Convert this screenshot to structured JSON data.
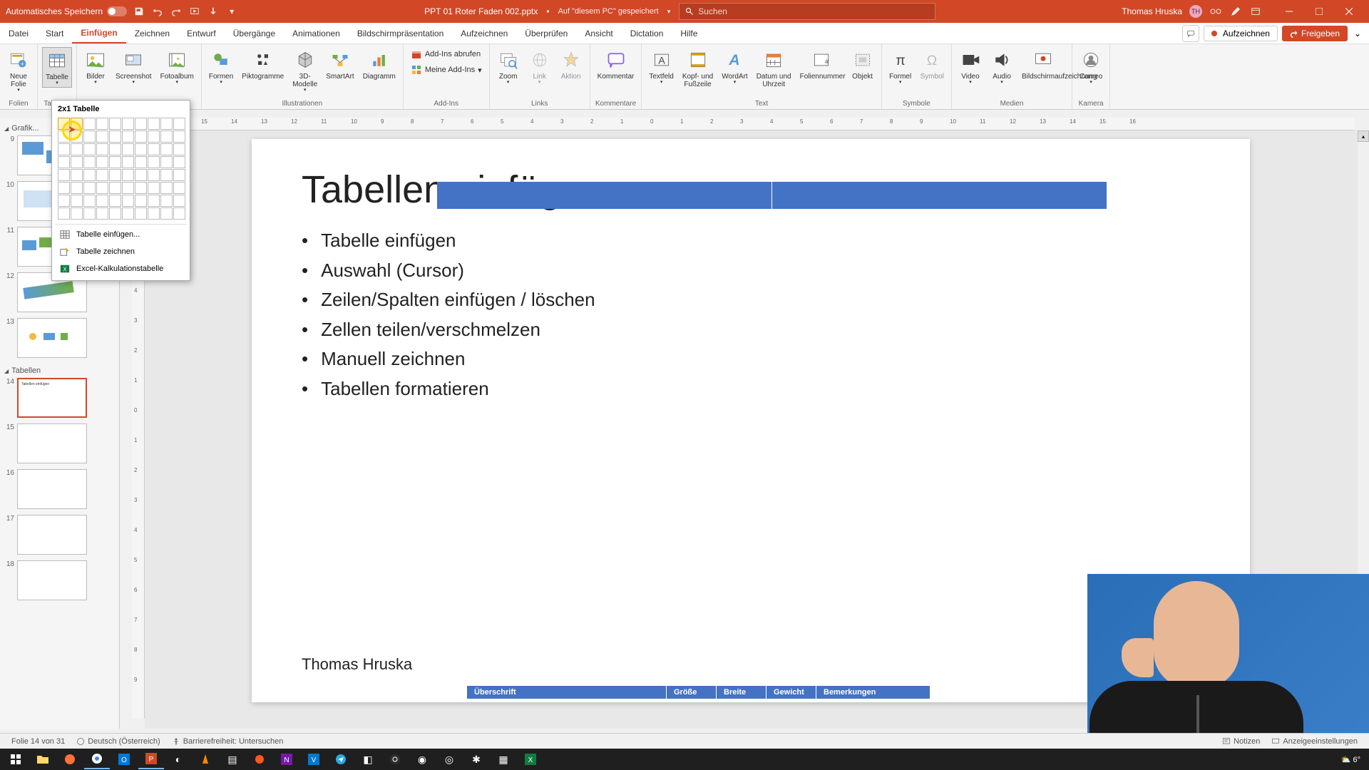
{
  "titlebar": {
    "autosave_label": "Automatisches Speichern",
    "filename": "PPT 01 Roter Faden 002.pptx",
    "saved_location": "Auf \"diesem PC\" gespeichert",
    "search_placeholder": "Suchen",
    "username": "Thomas Hruska",
    "user_initials": "TH"
  },
  "tabs": {
    "items": [
      "Datei",
      "Start",
      "Einfügen",
      "Zeichnen",
      "Entwurf",
      "Übergänge",
      "Animationen",
      "Bildschirmpräsentation",
      "Aufzeichnen",
      "Überprüfen",
      "Ansicht",
      "Dictation",
      "Hilfe"
    ],
    "active_index": 2,
    "record_label": "Aufzeichnen",
    "share_label": "Freigeben"
  },
  "ribbon": {
    "groups": {
      "folien": {
        "label": "Folien",
        "neue_folie": "Neue\nFolie"
      },
      "tabellen": {
        "label": "Tabellen",
        "tabelle": "Tabelle"
      },
      "bilder": {
        "label": "Bilder",
        "bilder": "Bilder",
        "screenshot": "Screenshot",
        "fotoalbum": "Fotoalbum"
      },
      "illustrationen": {
        "label": "Illustrationen",
        "formen": "Formen",
        "piktogramme": "Piktogramme",
        "3d": "3D-\nModelle",
        "smartart": "SmartArt",
        "diagramm": "Diagramm"
      },
      "addins": {
        "label": "Add-Ins",
        "abrufen": "Add-Ins abrufen",
        "meine": "Meine Add-Ins"
      },
      "links": {
        "label": "Links",
        "zoom": "Zoom",
        "link": "Link",
        "aktion": "Aktion"
      },
      "kommentare": {
        "label": "Kommentare",
        "kommentar": "Kommentar"
      },
      "text": {
        "label": "Text",
        "textfeld": "Textfeld",
        "kopf": "Kopf- und\nFußzeile",
        "wordart": "WordArt",
        "datum": "Datum und\nUhrzeit",
        "foliennummer": "Foliennummer",
        "objekt": "Objekt"
      },
      "symbole": {
        "label": "Symbole",
        "formel": "Formel",
        "symbol": "Symbol"
      },
      "medien": {
        "label": "Medien",
        "video": "Video",
        "audio": "Audio",
        "bildschirm": "Bildschirmaufzeichnung"
      },
      "kamera": {
        "label": "Kamera",
        "cameo": "Cameo"
      }
    }
  },
  "table_dropdown": {
    "title": "2x1 Tabelle",
    "cols_selected": 2,
    "rows_selected": 1,
    "insert_table": "Tabelle einfügen...",
    "draw_table": "Tabelle zeichnen",
    "excel_table": "Excel-Kalkulationstabelle"
  },
  "sidebar": {
    "section_grafik": "Grafik...",
    "section_tabellen": "Tabellen",
    "visible_slides": [
      9,
      10,
      11,
      12,
      13,
      14,
      15,
      16,
      17,
      18
    ],
    "active_slide": 14
  },
  "slide": {
    "title": "Tabellen einfügen",
    "bullets": [
      "Tabelle einfügen",
      "Auswahl (Cursor)",
      "Zeilen/Spalten einfügen / löschen",
      "Zellen teilen/verschmelzen",
      "Manuell zeichnen",
      "Tabellen formatieren"
    ],
    "author": "Thomas Hruska",
    "bottom_table_headers": [
      "Überschrift",
      "Größe",
      "Breite",
      "Gewicht",
      "Bemerkungen"
    ]
  },
  "statusbar": {
    "slide_pos": "Folie 14 von 31",
    "language": "Deutsch (Österreich)",
    "accessibility": "Barrierefreiheit: Untersuchen",
    "notes": "Notizen",
    "display_settings": "Anzeigeeinstellungen"
  },
  "taskbar": {
    "temp": "6°"
  }
}
